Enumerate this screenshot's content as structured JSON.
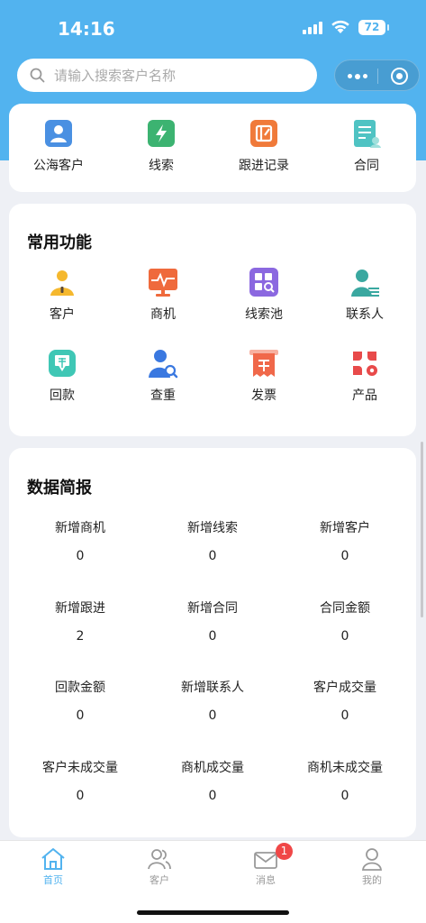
{
  "status": {
    "time": "14:16",
    "battery": "72"
  },
  "search": {
    "placeholder": "请输入搜索客户名称"
  },
  "quick": {
    "items": [
      {
        "label": "公海客户",
        "icon": "public-customer-icon",
        "color": "#4a90e2"
      },
      {
        "label": "线索",
        "icon": "lead-icon",
        "color": "#3cb371"
      },
      {
        "label": "跟进记录",
        "icon": "follow-record-icon",
        "color": "#f07a3a"
      },
      {
        "label": "合同",
        "icon": "contract-icon",
        "color": "#4fc3c3"
      }
    ]
  },
  "functions": {
    "title": "常用功能",
    "items": [
      {
        "label": "客户",
        "icon": "customer-icon",
        "color": "#f5b82e"
      },
      {
        "label": "商机",
        "icon": "opportunity-icon",
        "color": "#ef6a3c"
      },
      {
        "label": "线索池",
        "icon": "lead-pool-icon",
        "color": "#8b68e0"
      },
      {
        "label": "联系人",
        "icon": "contact-icon",
        "color": "#3aa8a0"
      },
      {
        "label": "回款",
        "icon": "payment-icon",
        "color": "#3fc7b5"
      },
      {
        "label": "查重",
        "icon": "duplicate-check-icon",
        "color": "#3a78e0"
      },
      {
        "label": "发票",
        "icon": "invoice-icon",
        "color": "#f0684a"
      },
      {
        "label": "产品",
        "icon": "product-icon",
        "color": "#e84a4a"
      }
    ]
  },
  "report": {
    "title": "数据简报",
    "stats": [
      {
        "label": "新增商机",
        "value": "0"
      },
      {
        "label": "新增线索",
        "value": "0"
      },
      {
        "label": "新增客户",
        "value": "0"
      },
      {
        "label": "新增跟进",
        "value": "2"
      },
      {
        "label": "新增合同",
        "value": "0"
      },
      {
        "label": "合同金额",
        "value": "0"
      },
      {
        "label": "回款金额",
        "value": "0"
      },
      {
        "label": "新增联系人",
        "value": "0"
      },
      {
        "label": "客户成交量",
        "value": "0"
      },
      {
        "label": "客户未成交量",
        "value": "0"
      },
      {
        "label": "商机成交量",
        "value": "0"
      },
      {
        "label": "商机未成交量",
        "value": "0"
      }
    ]
  },
  "tabbar": {
    "items": [
      {
        "label": "首页",
        "icon": "home-icon",
        "active": true
      },
      {
        "label": "客户",
        "icon": "customers-icon",
        "active": false
      },
      {
        "label": "消息",
        "icon": "message-icon",
        "active": false,
        "badge": "1"
      },
      {
        "label": "我的",
        "icon": "profile-icon",
        "active": false
      }
    ]
  },
  "colors": {
    "accent": "#52b3ef",
    "badge": "#f04747",
    "background": "#eef0f5"
  }
}
